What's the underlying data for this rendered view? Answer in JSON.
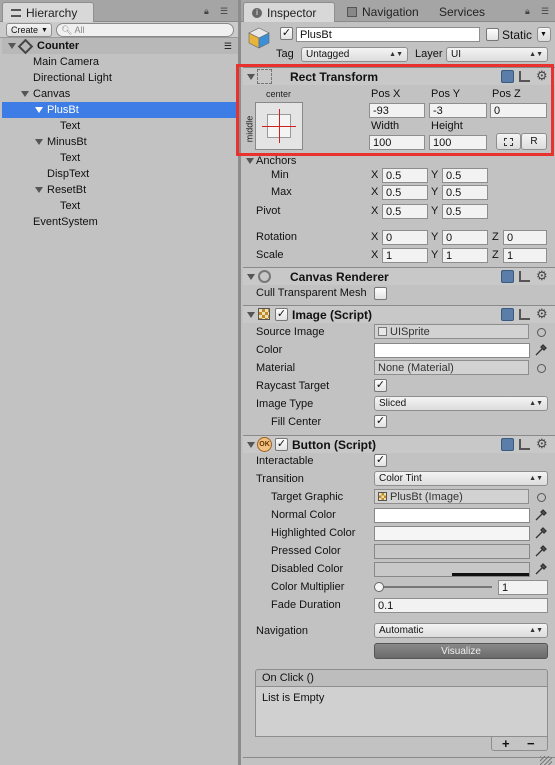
{
  "hierarchy": {
    "tab_label": "Hierarchy",
    "create_label": "Create",
    "search_placeholder": "All",
    "scene_name": "Counter",
    "items": [
      {
        "label": "Main Camera"
      },
      {
        "label": "Directional Light"
      },
      {
        "label": "Canvas"
      },
      {
        "label": "PlusBt"
      },
      {
        "label": "Text"
      },
      {
        "label": "MinusBt"
      },
      {
        "label": "Text"
      },
      {
        "label": "DispText"
      },
      {
        "label": "ResetBt"
      },
      {
        "label": "Text"
      },
      {
        "label": "EventSystem"
      }
    ]
  },
  "inspector": {
    "tabs": [
      {
        "label": "Inspector"
      },
      {
        "label": "Navigation"
      },
      {
        "label": "Services"
      }
    ],
    "object_name": "PlusBt",
    "static_label": "Static",
    "tag_label": "Tag",
    "tag_value": "Untagged",
    "layer_label": "Layer",
    "layer_value": "UI",
    "rect_transform": {
      "title": "Rect Transform",
      "anchor_h": "center",
      "anchor_v": "middle",
      "pos_x_label": "Pos X",
      "pos_y_label": "Pos Y",
      "pos_z_label": "Pos Z",
      "pos_x": "-93",
      "pos_y": "-3",
      "pos_z": "0",
      "width_label": "Width",
      "height_label": "Height",
      "width": "100",
      "height": "100",
      "r_button": "R",
      "anchors_label": "Anchors",
      "min_label": "Min",
      "max_label": "Max",
      "min_x": "0.5",
      "min_y": "0.5",
      "max_x": "0.5",
      "max_y": "0.5",
      "pivot_label": "Pivot",
      "pivot_x": "0.5",
      "pivot_y": "0.5",
      "rotation_label": "Rotation",
      "rot_x": "0",
      "rot_y": "0",
      "rot_z": "0",
      "scale_label": "Scale",
      "scale_x": "1",
      "scale_y": "1",
      "scale_z": "1",
      "x": "X",
      "y": "Y",
      "z": "Z"
    },
    "canvas_renderer": {
      "title": "Canvas Renderer",
      "cull_label": "Cull Transparent Mesh"
    },
    "image": {
      "title": "Image (Script)",
      "source_image_label": "Source Image",
      "source_image": "UISprite",
      "color_label": "Color",
      "material_label": "Material",
      "material": "None (Material)",
      "raycast_label": "Raycast Target",
      "image_type_label": "Image Type",
      "image_type": "Sliced",
      "fill_center_label": "Fill Center"
    },
    "button": {
      "title": "Button (Script)",
      "interactable_label": "Interactable",
      "transition_label": "Transition",
      "transition": "Color Tint",
      "target_graphic_label": "Target Graphic",
      "target_graphic": "PlusBt (Image)",
      "normal_color_label": "Normal Color",
      "highlighted_color_label": "Highlighted Color",
      "pressed_color_label": "Pressed Color",
      "disabled_color_label": "Disabled Color",
      "color_multiplier_label": "Color Multiplier",
      "color_multiplier": "1",
      "color_multiplier_fraction": 0.2,
      "fade_duration_label": "Fade Duration",
      "fade_duration": "0.1",
      "navigation_label": "Navigation",
      "navigation": "Automatic",
      "visualize_label": "Visualize",
      "onclick_label": "On Click ()",
      "list_empty": "List is Empty",
      "plus": "+",
      "minus": "−"
    }
  }
}
